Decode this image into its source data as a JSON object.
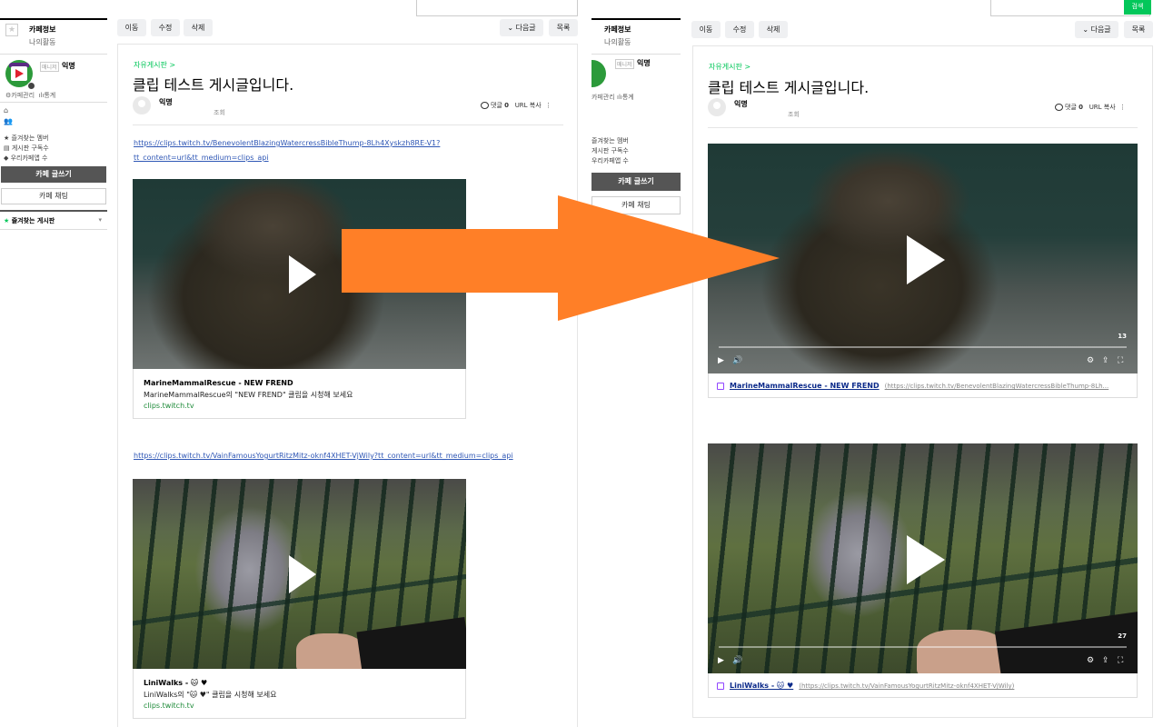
{
  "cafe_sidebar": {
    "cafe_info_tab": "카페정보",
    "my_activity_tab": "나의활동",
    "manager_badge": "매니저",
    "nickname": "익명",
    "cafe_manage": "카페관리",
    "stats": "통계",
    "stat_items": [
      "즐겨찾는 멤버",
      "게시판 구독수",
      "우리카페앱 수"
    ],
    "write_button": "카페 글쓰기",
    "chat_button": "카페 채팅",
    "favorite_boards": "즐겨찾는 게시판"
  },
  "toolbar": {
    "move": "이동",
    "edit": "수정",
    "delete": "삭제",
    "next_post": "다음글",
    "list": "목록",
    "search": "검색"
  },
  "post": {
    "board": "자유게시판 >",
    "title": "클립 테스트 게시글입니다.",
    "author": "익명",
    "views_label": "조회",
    "comments_label": "댓글",
    "comments_count": "0",
    "copy_url": "URL 복사"
  },
  "clips": [
    {
      "url": "https://clips.twitch.tv/BenevolentBlazingWatercressBibleThump-8Lh4Xyskzh8RE-V1?tt_content=url&tt_medium=clips_api",
      "embed_url": "(https://clips.twitch.tv/BenevolentBlazingWatercressBibleThump-8Lh...",
      "title": "MarineMammalRescue - NEW FREND",
      "description": "MarineMammalRescue의 \"NEW FREND\" 클립을 시청해 보세요",
      "domain": "clips.twitch.tv",
      "duration": "13"
    },
    {
      "url": "https://clips.twitch.tv/VainFamousYogurtRitzMitz-oknf4XHET-VjWily?tt_content=url&tt_medium=clips_api",
      "embed_url": "(https://clips.twitch.tv/VainFamousYogurtRitzMitz-oknf4XHET-VjWily)",
      "title": "LiniWalks - 🐱 ♥",
      "description": "LiniWalks의 \"🐱 ♥\" 클립을 시청해 보세요",
      "domain": "clips.twitch.tv",
      "duration": "27"
    }
  ],
  "colors": {
    "accent_green": "#03c75a",
    "arrow_orange": "#ff7f27",
    "link_blue": "#2f57b5"
  }
}
